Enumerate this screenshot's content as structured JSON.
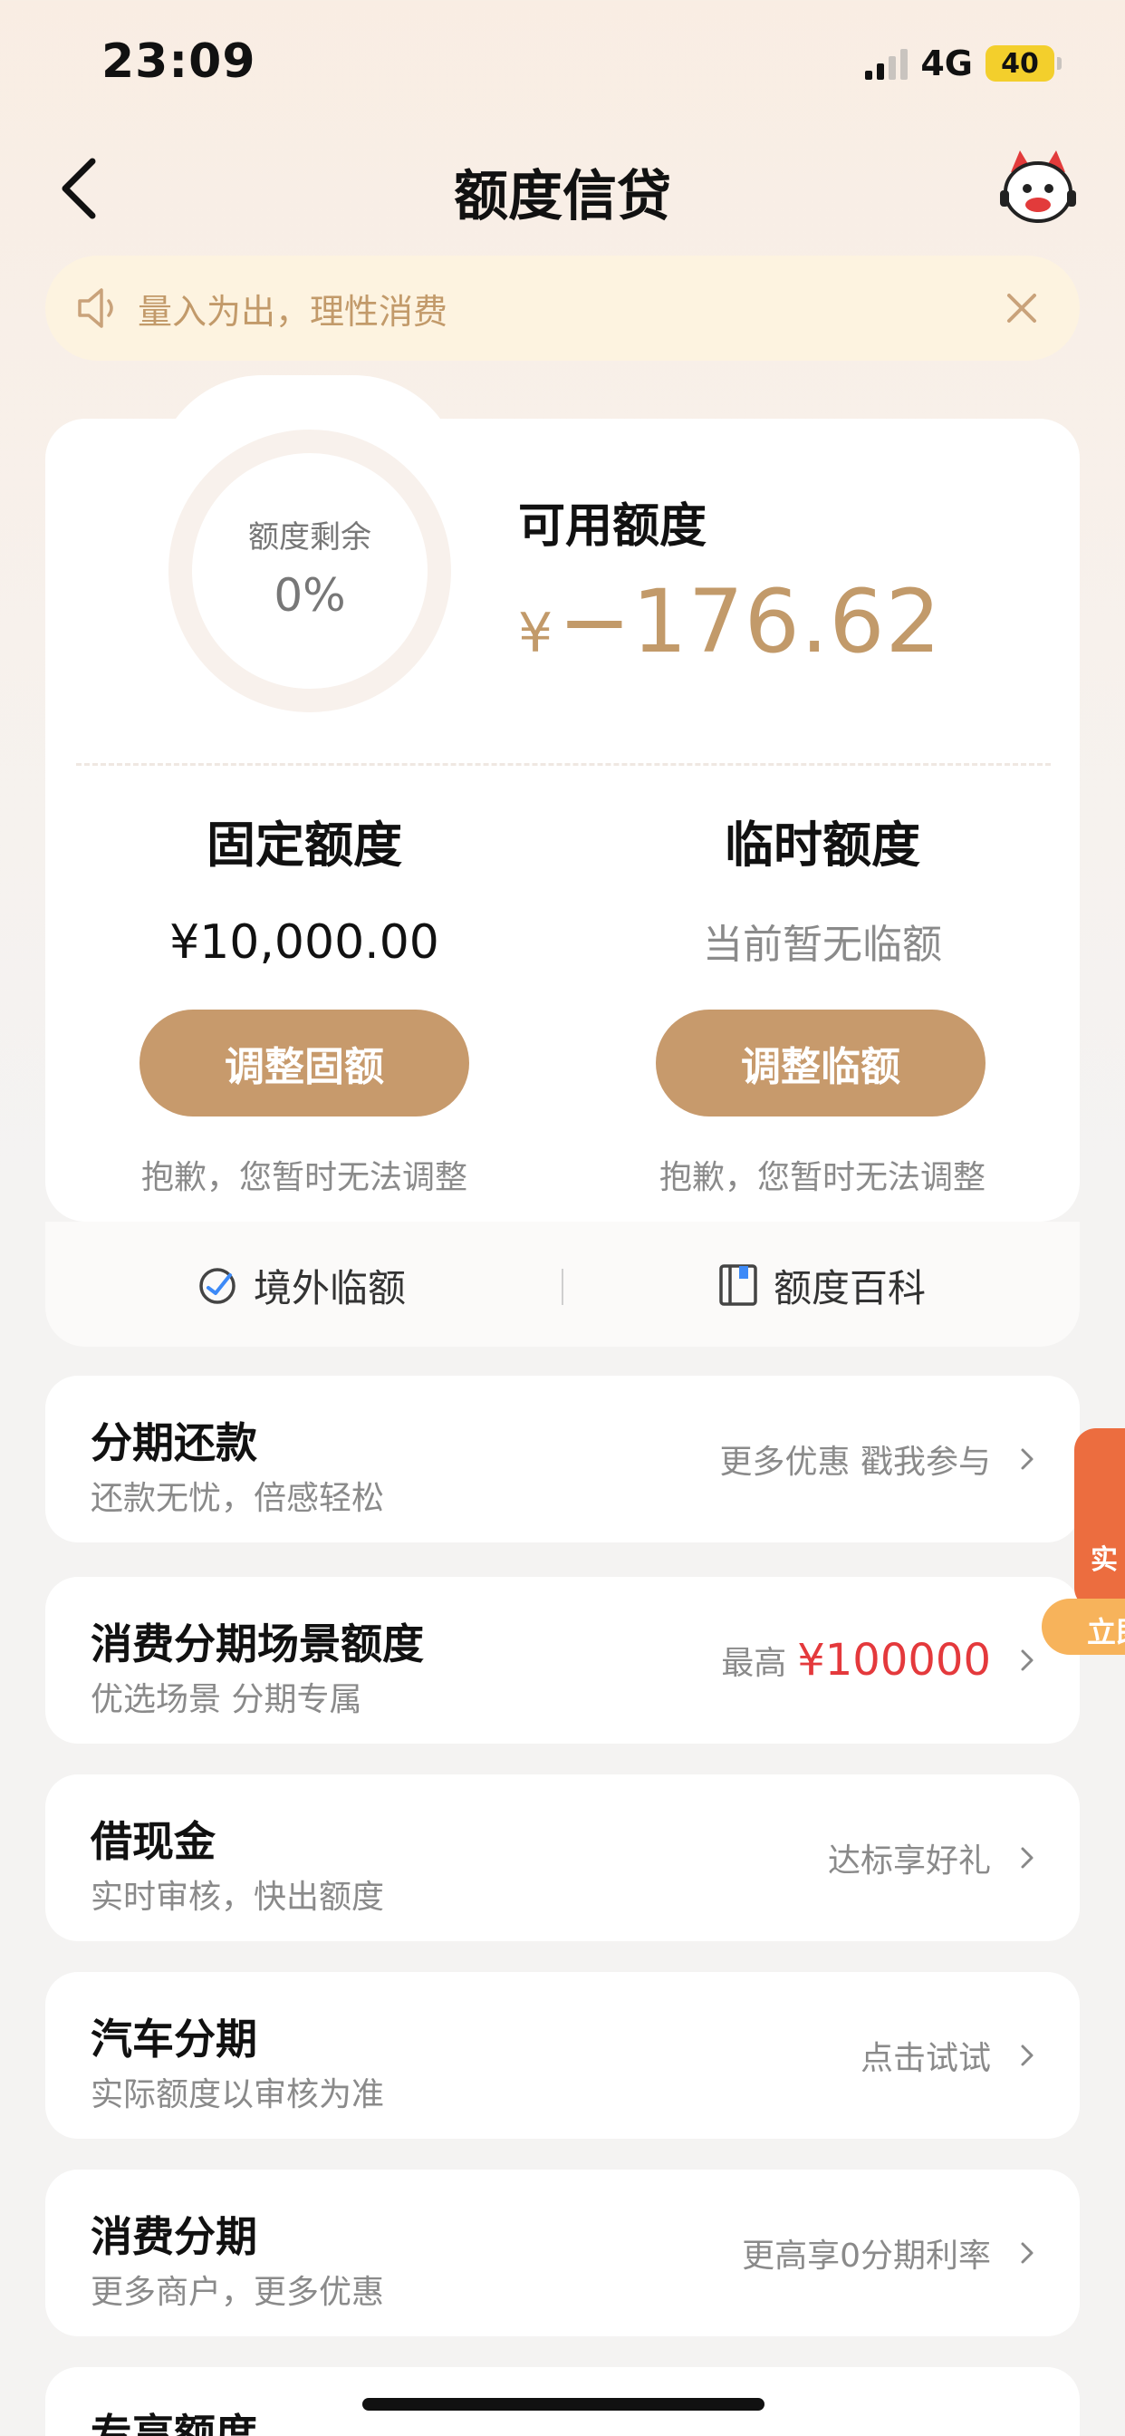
{
  "status_bar": {
    "time": "23:09",
    "network": "4G",
    "battery": "40"
  },
  "nav": {
    "title": "额度信贷"
  },
  "notice": {
    "text": "量入为出，理性消费"
  },
  "quota_card": {
    "ring_label": "额度剩余",
    "ring_percent": "0%",
    "available_label": "可用额度",
    "available_currency": "¥",
    "available_value": "−176.62",
    "fixed": {
      "title": "固定额度",
      "value": "¥10,000.00",
      "button": "调整固额",
      "note": "抱歉，您暂时无法调整"
    },
    "temporary": {
      "title": "临时额度",
      "value": "当前暂无临额",
      "button": "调整临额",
      "note": "抱歉，您暂时无法调整"
    },
    "links": {
      "overseas": "境外临额",
      "wiki": "额度百科"
    }
  },
  "list": [
    {
      "title": "分期还款",
      "subtitle": "还款无忧，倍感轻松",
      "right": "更多优惠 戳我参与"
    },
    {
      "title": "消费分期场景额度",
      "subtitle": "优选场景 分期专属",
      "right_prefix": "最高",
      "right_highlight": "¥100000"
    },
    {
      "title": "借现金",
      "subtitle": "实时审核，快出额度",
      "right": "达标享好礼"
    },
    {
      "title": "汽车分期",
      "subtitle": "实际额度以审核为准",
      "right": "点击试试"
    },
    {
      "title": "消费分期",
      "subtitle": "更多商户，更多优惠",
      "right": "更高享0分期利率"
    },
    {
      "title": "专享额度"
    }
  ],
  "promo": {
    "box_text": "实",
    "tag_text": "立即"
  },
  "colors": {
    "accent": "#c79a6c",
    "gold_text": "#c29a6a",
    "highlight_red": "#e4393c",
    "notice_bg": "#fdf3e0"
  },
  "icons": [
    "back-arrow-icon",
    "mascot-avatar-icon",
    "speaker-icon",
    "close-icon",
    "globe-plane-icon",
    "book-icon",
    "chevron-right-icon"
  ]
}
